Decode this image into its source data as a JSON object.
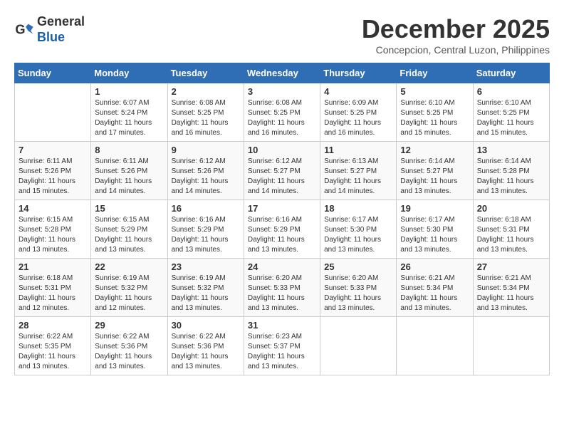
{
  "header": {
    "logo_line1": "General",
    "logo_line2": "Blue",
    "month_title": "December 2025",
    "location": "Concepcion, Central Luzon, Philippines"
  },
  "weekdays": [
    "Sunday",
    "Monday",
    "Tuesday",
    "Wednesday",
    "Thursday",
    "Friday",
    "Saturday"
  ],
  "weeks": [
    [
      {
        "day": "",
        "info": ""
      },
      {
        "day": "1",
        "info": "Sunrise: 6:07 AM\nSunset: 5:24 PM\nDaylight: 11 hours\nand 17 minutes."
      },
      {
        "day": "2",
        "info": "Sunrise: 6:08 AM\nSunset: 5:25 PM\nDaylight: 11 hours\nand 16 minutes."
      },
      {
        "day": "3",
        "info": "Sunrise: 6:08 AM\nSunset: 5:25 PM\nDaylight: 11 hours\nand 16 minutes."
      },
      {
        "day": "4",
        "info": "Sunrise: 6:09 AM\nSunset: 5:25 PM\nDaylight: 11 hours\nand 16 minutes."
      },
      {
        "day": "5",
        "info": "Sunrise: 6:10 AM\nSunset: 5:25 PM\nDaylight: 11 hours\nand 15 minutes."
      },
      {
        "day": "6",
        "info": "Sunrise: 6:10 AM\nSunset: 5:25 PM\nDaylight: 11 hours\nand 15 minutes."
      }
    ],
    [
      {
        "day": "7",
        "info": "Sunrise: 6:11 AM\nSunset: 5:26 PM\nDaylight: 11 hours\nand 15 minutes."
      },
      {
        "day": "8",
        "info": "Sunrise: 6:11 AM\nSunset: 5:26 PM\nDaylight: 11 hours\nand 14 minutes."
      },
      {
        "day": "9",
        "info": "Sunrise: 6:12 AM\nSunset: 5:26 PM\nDaylight: 11 hours\nand 14 minutes."
      },
      {
        "day": "10",
        "info": "Sunrise: 6:12 AM\nSunset: 5:27 PM\nDaylight: 11 hours\nand 14 minutes."
      },
      {
        "day": "11",
        "info": "Sunrise: 6:13 AM\nSunset: 5:27 PM\nDaylight: 11 hours\nand 14 minutes."
      },
      {
        "day": "12",
        "info": "Sunrise: 6:14 AM\nSunset: 5:27 PM\nDaylight: 11 hours\nand 13 minutes."
      },
      {
        "day": "13",
        "info": "Sunrise: 6:14 AM\nSunset: 5:28 PM\nDaylight: 11 hours\nand 13 minutes."
      }
    ],
    [
      {
        "day": "14",
        "info": "Sunrise: 6:15 AM\nSunset: 5:28 PM\nDaylight: 11 hours\nand 13 minutes."
      },
      {
        "day": "15",
        "info": "Sunrise: 6:15 AM\nSunset: 5:29 PM\nDaylight: 11 hours\nand 13 minutes."
      },
      {
        "day": "16",
        "info": "Sunrise: 6:16 AM\nSunset: 5:29 PM\nDaylight: 11 hours\nand 13 minutes."
      },
      {
        "day": "17",
        "info": "Sunrise: 6:16 AM\nSunset: 5:29 PM\nDaylight: 11 hours\nand 13 minutes."
      },
      {
        "day": "18",
        "info": "Sunrise: 6:17 AM\nSunset: 5:30 PM\nDaylight: 11 hours\nand 13 minutes."
      },
      {
        "day": "19",
        "info": "Sunrise: 6:17 AM\nSunset: 5:30 PM\nDaylight: 11 hours\nand 13 minutes."
      },
      {
        "day": "20",
        "info": "Sunrise: 6:18 AM\nSunset: 5:31 PM\nDaylight: 11 hours\nand 13 minutes."
      }
    ],
    [
      {
        "day": "21",
        "info": "Sunrise: 6:18 AM\nSunset: 5:31 PM\nDaylight: 11 hours\nand 12 minutes."
      },
      {
        "day": "22",
        "info": "Sunrise: 6:19 AM\nSunset: 5:32 PM\nDaylight: 11 hours\nand 12 minutes."
      },
      {
        "day": "23",
        "info": "Sunrise: 6:19 AM\nSunset: 5:32 PM\nDaylight: 11 hours\nand 13 minutes."
      },
      {
        "day": "24",
        "info": "Sunrise: 6:20 AM\nSunset: 5:33 PM\nDaylight: 11 hours\nand 13 minutes."
      },
      {
        "day": "25",
        "info": "Sunrise: 6:20 AM\nSunset: 5:33 PM\nDaylight: 11 hours\nand 13 minutes."
      },
      {
        "day": "26",
        "info": "Sunrise: 6:21 AM\nSunset: 5:34 PM\nDaylight: 11 hours\nand 13 minutes."
      },
      {
        "day": "27",
        "info": "Sunrise: 6:21 AM\nSunset: 5:34 PM\nDaylight: 11 hours\nand 13 minutes."
      }
    ],
    [
      {
        "day": "28",
        "info": "Sunrise: 6:22 AM\nSunset: 5:35 PM\nDaylight: 11 hours\nand 13 minutes."
      },
      {
        "day": "29",
        "info": "Sunrise: 6:22 AM\nSunset: 5:36 PM\nDaylight: 11 hours\nand 13 minutes."
      },
      {
        "day": "30",
        "info": "Sunrise: 6:22 AM\nSunset: 5:36 PM\nDaylight: 11 hours\nand 13 minutes."
      },
      {
        "day": "31",
        "info": "Sunrise: 6:23 AM\nSunset: 5:37 PM\nDaylight: 11 hours\nand 13 minutes."
      },
      {
        "day": "",
        "info": ""
      },
      {
        "day": "",
        "info": ""
      },
      {
        "day": "",
        "info": ""
      }
    ]
  ]
}
